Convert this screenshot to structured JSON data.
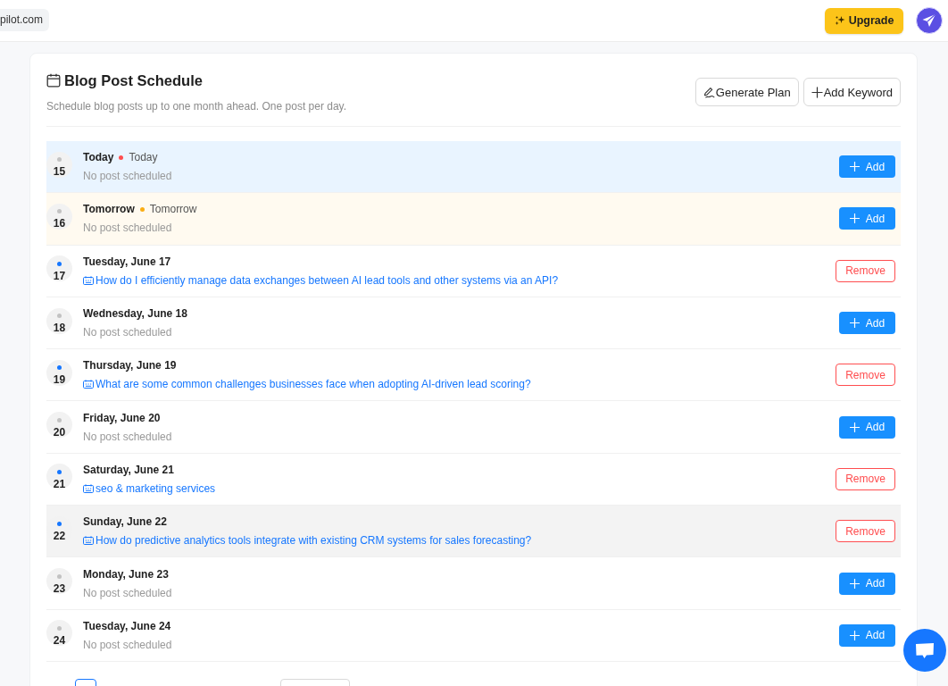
{
  "top_bar": {
    "site_label": "pilot.com",
    "upgrade_label": "Upgrade"
  },
  "schedule": {
    "title": "Blog Post Schedule",
    "subtitle": "Schedule blog posts up to one month ahead. One post per day.",
    "actions": [
      {
        "kind": "generate",
        "label": "Generate Plan"
      },
      {
        "kind": "add",
        "label": "Add Keyword"
      }
    ],
    "days": [
      {
        "day": "15",
        "title": "Today",
        "tag": {
          "kind": "today",
          "label": "Today",
          "color": "#ff4d4f"
        },
        "scheduled": false,
        "hovered": false,
        "note": "No post scheduled",
        "button": {
          "kind": "add",
          "label": "Add"
        }
      },
      {
        "day": "16",
        "title": "Tomorrow",
        "tag": {
          "kind": "tomorrow",
          "label": "Tomorrow",
          "color": "#faad14"
        },
        "scheduled": false,
        "hovered": false,
        "note": "No post scheduled",
        "button": {
          "kind": "add",
          "label": "Add"
        }
      },
      {
        "day": "17",
        "title": "Tuesday, June 17",
        "scheduled": true,
        "hovered": false,
        "post": "How do I efficiently manage data exchanges between AI lead tools and other systems via an API?",
        "button": {
          "kind": "remove",
          "label": "Remove"
        }
      },
      {
        "day": "18",
        "title": "Wednesday, June 18",
        "scheduled": false,
        "hovered": false,
        "note": "No post scheduled",
        "button": {
          "kind": "add",
          "label": "Add"
        }
      },
      {
        "day": "19",
        "title": "Thursday, June 19",
        "scheduled": true,
        "hovered": false,
        "post": "What are some common challenges businesses face when adopting AI-driven lead scoring?",
        "button": {
          "kind": "remove",
          "label": "Remove"
        }
      },
      {
        "day": "20",
        "title": "Friday, June 20",
        "scheduled": false,
        "hovered": false,
        "note": "No post scheduled",
        "button": {
          "kind": "add",
          "label": "Add"
        }
      },
      {
        "day": "21",
        "title": "Saturday, June 21",
        "scheduled": true,
        "hovered": false,
        "post": "seo & marketing services",
        "button": {
          "kind": "remove",
          "label": "Remove"
        }
      },
      {
        "day": "22",
        "title": "Sunday, June 22",
        "scheduled": true,
        "hovered": true,
        "post": "How do predictive analytics tools integrate with existing CRM systems for sales forecasting?",
        "button": {
          "kind": "remove",
          "label": "Remove"
        }
      },
      {
        "day": "23",
        "title": "Monday, June 23",
        "scheduled": false,
        "hovered": false,
        "note": "No post scheduled",
        "button": {
          "kind": "add",
          "label": "Add"
        }
      },
      {
        "day": "24",
        "title": "Tuesday, June 24",
        "scheduled": false,
        "hovered": false,
        "note": "No post scheduled",
        "button": {
          "kind": "add",
          "label": "Add"
        }
      }
    ],
    "pagination": {
      "pages": [
        {
          "selected": true
        }
      ],
      "size_changer": true
    }
  }
}
